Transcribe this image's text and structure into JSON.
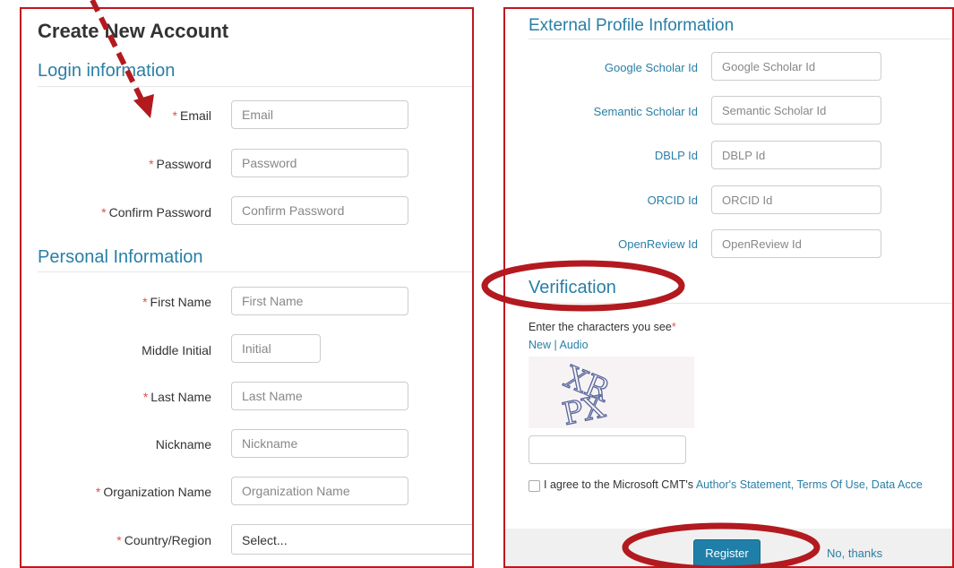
{
  "left": {
    "title": "Create New Account",
    "login_section": "Login information",
    "email": {
      "label": "Email",
      "placeholder": "Email",
      "required": "*"
    },
    "password": {
      "label": "Password",
      "placeholder": "Password",
      "required": "*"
    },
    "confirm_password": {
      "label": "Confirm Password",
      "placeholder": "Confirm Password",
      "required": "*"
    },
    "personal_section": "Personal Information",
    "first_name": {
      "label": "First Name",
      "placeholder": "First Name",
      "required": "*"
    },
    "middle_initial": {
      "label": "Middle Initial",
      "placeholder": "Initial"
    },
    "last_name": {
      "label": "Last Name",
      "placeholder": "Last Name",
      "required": "*"
    },
    "nickname": {
      "label": "Nickname",
      "placeholder": "Nickname"
    },
    "organization": {
      "label": "Organization Name",
      "placeholder": "Organization Name",
      "required": "*"
    },
    "country": {
      "label": "Country/Region",
      "value": "Select...",
      "required": "*"
    }
  },
  "right": {
    "external_section": "External Profile Information",
    "google_scholar": {
      "label": "Google Scholar Id",
      "placeholder": "Google Scholar Id"
    },
    "semantic_scholar": {
      "label": "Semantic Scholar Id",
      "placeholder": "Semantic Scholar Id"
    },
    "dblp": {
      "label": "DBLP Id",
      "placeholder": "DBLP Id"
    },
    "orcid": {
      "label": "ORCID Id",
      "placeholder": "ORCID Id"
    },
    "openreview": {
      "label": "OpenReview Id",
      "placeholder": "OpenReview Id"
    },
    "verification_section": "Verification",
    "captcha_prompt": "Enter the characters you see",
    "captcha_required": "*",
    "captcha_new": "New",
    "captcha_sep": "|",
    "captcha_audio": "Audio",
    "captcha_text_1": "XR",
    "captcha_text_2": "PX",
    "agree_text": "I agree to the Microsoft CMT's",
    "agree_links": "Author's Statement, Terms Of Use, Data Acce",
    "register_label": "Register",
    "no_thanks_label": "No, thanks"
  },
  "colors": {
    "accent": "#2a7fa6",
    "annotation": "#c0161e",
    "required": "#d9534f",
    "button": "#1f7fa8"
  }
}
